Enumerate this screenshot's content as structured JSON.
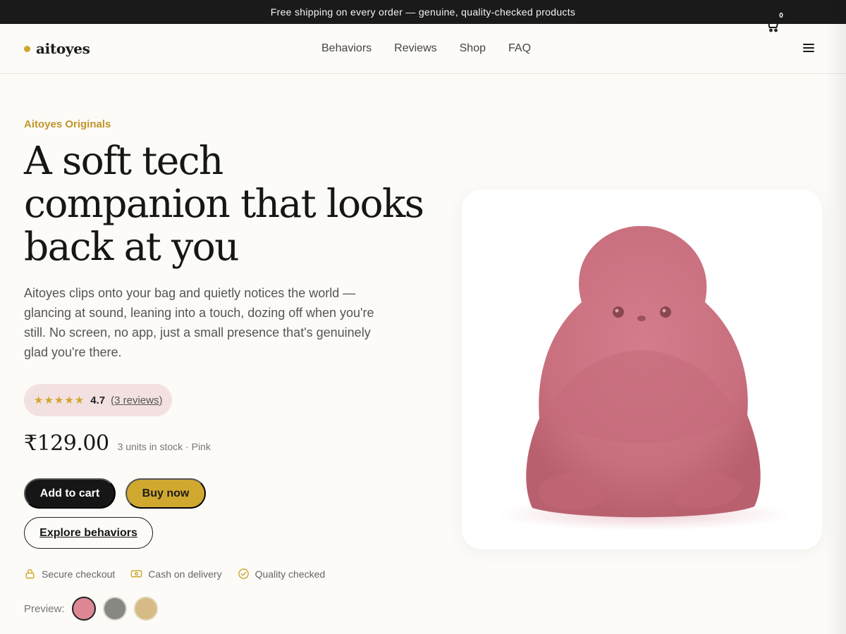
{
  "announcement": "Free shipping on every order — genuine, quality-checked products",
  "brand": {
    "name": "aitoyes",
    "accent_color": "#cfa62b"
  },
  "nav": [
    "Behaviors",
    "Reviews",
    "Shop",
    "FAQ"
  ],
  "cart": {
    "count": "0",
    "icon": "cart-icon"
  },
  "menu_icon": "hamburger-icon",
  "hero": {
    "eyebrow": "Aitoyes Originals",
    "title_lines": [
      "A soft tech",
      "companion that looks",
      "back at you"
    ],
    "description": "Aitoyes clips onto your bag and quietly notices the world — glancing at sound, leaning into a touch, dozing off when you're still. No screen, no app, just a small presence that's genuinely glad you're there."
  },
  "rating": {
    "stars": "★★★★★",
    "value": "4.7",
    "count_label": "(3 reviews)"
  },
  "price": {
    "amount": "₹129.00",
    "stock": "3 units in stock · Pink"
  },
  "buttons": {
    "add_to_cart": "Add to cart",
    "buy_now": "Buy now",
    "explore": "Explore behaviors"
  },
  "trust": [
    {
      "icon": "lock-icon",
      "label": "Secure checkout"
    },
    {
      "icon": "cash-icon",
      "label": "Cash on delivery"
    },
    {
      "icon": "check-circle-icon",
      "label": "Quality checked"
    }
  ],
  "preview": {
    "label": "Preview:",
    "swatches": [
      {
        "name": "Pink",
        "color": "#de8795",
        "selected": true
      },
      {
        "name": "Gray",
        "color": "#888883",
        "selected": false
      },
      {
        "name": "Sand",
        "color": "#d6bb87",
        "selected": false
      }
    ]
  },
  "colors": {
    "dark": "#161616",
    "gold": "#d1a82f",
    "rating_bg": "#f3e1e1"
  }
}
